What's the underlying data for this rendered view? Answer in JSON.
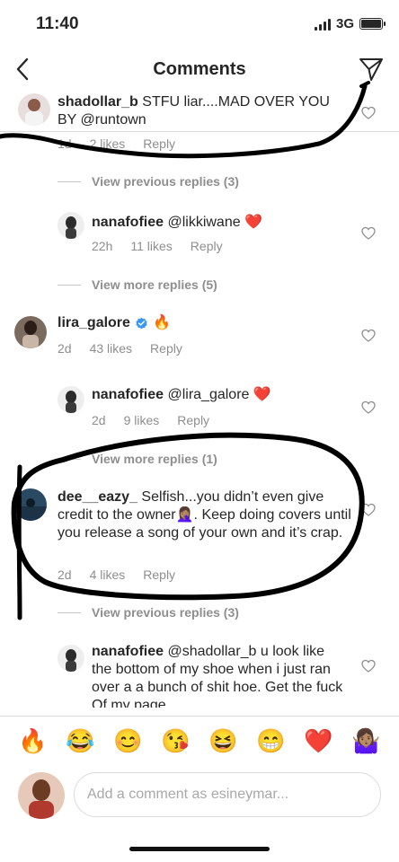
{
  "status": {
    "time": "11:40",
    "network": "3G"
  },
  "nav": {
    "title": "Comments"
  },
  "comments": [
    {
      "username": "shadollar_b",
      "text": "STFU liar....MAD OVER YOU BY @runtown",
      "time": "1d",
      "likes": "2 likes",
      "reply": "Reply"
    },
    {
      "view": "View previous replies (3)"
    },
    {
      "username": "nanafofiee",
      "text": "@likkiwane ❤️",
      "time": "22h",
      "likes": "11 likes",
      "reply": "Reply"
    },
    {
      "view": "View more replies (5)"
    },
    {
      "username": "lira_galore",
      "text": "🔥",
      "time": "2d",
      "likes": "43 likes",
      "reply": "Reply",
      "verified": true
    },
    {
      "username": "nanafofiee",
      "text": "@lira_galore ❤️",
      "time": "2d",
      "likes": "9 likes",
      "reply": "Reply"
    },
    {
      "view": "View more replies (1)"
    },
    {
      "username": "dee__eazy_",
      "text": "Selfish...you didn’t even give credit to the owner🤦🏽‍♀️. Keep doing covers until you release a song of your own and it’s crap.",
      "time": "2d",
      "likes": "4 likes",
      "reply": "Reply"
    },
    {
      "view": "View previous replies (3)"
    },
    {
      "username": "nanafofiee",
      "text": "@shadollar_b u look like the bottom of my shoe when i just ran over a a bunch of shit hoe. Get the fuck  Of my page"
    }
  ],
  "emojis": [
    "🔥",
    "😂",
    "😊",
    "😘",
    "😆",
    "😁",
    "❤️",
    "🤷🏽‍♀️"
  ],
  "input": {
    "placeholder": "Add a comment as esineymar..."
  },
  "colors": {
    "accent": "#3897f0",
    "heart": "#ed1c24",
    "muted": "#8e8e8e"
  }
}
